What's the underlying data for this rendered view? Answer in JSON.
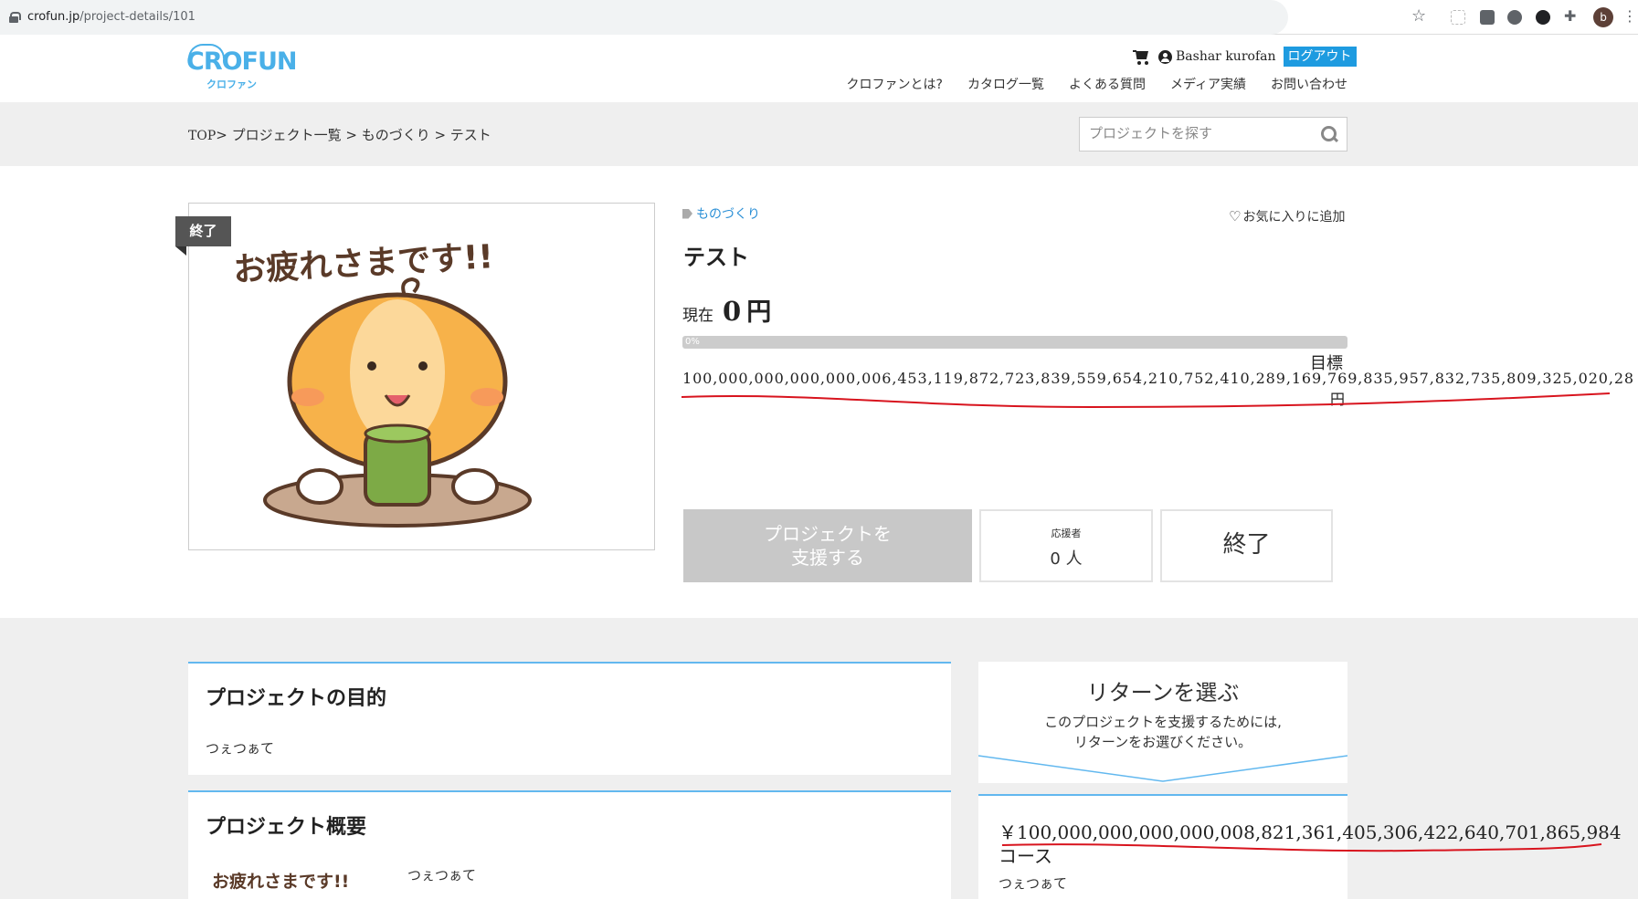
{
  "browser": {
    "domain": "crofun.jp",
    "path": "/project-details/101",
    "profile_initial": "b"
  },
  "header": {
    "logo_main": "CROFUN",
    "logo_sub": "クロファン",
    "user_name": "Bashar kurofan",
    "logout_label": "ログアウト",
    "nav": [
      "クロファンとは?",
      "カタログ一覧",
      "よくある質問",
      "メディア実績",
      "お問い合わせ"
    ]
  },
  "breadcrumb": {
    "top": "TOP",
    "rest": "> プロジェクト一覧 > ものづくり > テスト"
  },
  "search": {
    "placeholder": "プロジェクトを探す"
  },
  "project": {
    "ended_tag": "終了",
    "image_caption": "お疲れさまです!!",
    "category": "ものづくり",
    "favorite_label": "お気に入りに追加",
    "title": "テスト",
    "current_label": "現在",
    "current_value": "0",
    "current_unit": "円",
    "progress_percent": 0,
    "progress_text": "0%",
    "goal_label": "目標",
    "goal_value": "100,000,000,000,000,006,453,119,872,723,839,559,654,210,752,410,289,169,769,835,957,832,735,809,325,020,28",
    "goal_unit": "円",
    "support_button": "プロジェクトを\n支援する",
    "supporters_label": "応援者",
    "supporters_value": "0 人",
    "status": "終了"
  },
  "sections": {
    "purpose_title": "プロジェクトの目的",
    "purpose_text": "つぇつぁて",
    "overview_title": "プロジェクト概要",
    "overview_caption": "お疲れさまです!!",
    "overview_text": "つぇつぁて"
  },
  "returns": {
    "title": "リターンを選ぶ",
    "subtitle_line1": "このプロジェクトを支援するためには,",
    "subtitle_line2": "リターンをお選びください。",
    "course_price": "￥100,000,000,000,000,008,821,361,405,306,422,640,701,865,984",
    "course_label": "コース",
    "course_desc": "つぇつぁて"
  },
  "colors": {
    "accent": "#1e9be0",
    "card_border": "#62b8ef",
    "annotation_red": "#d8141e"
  }
}
